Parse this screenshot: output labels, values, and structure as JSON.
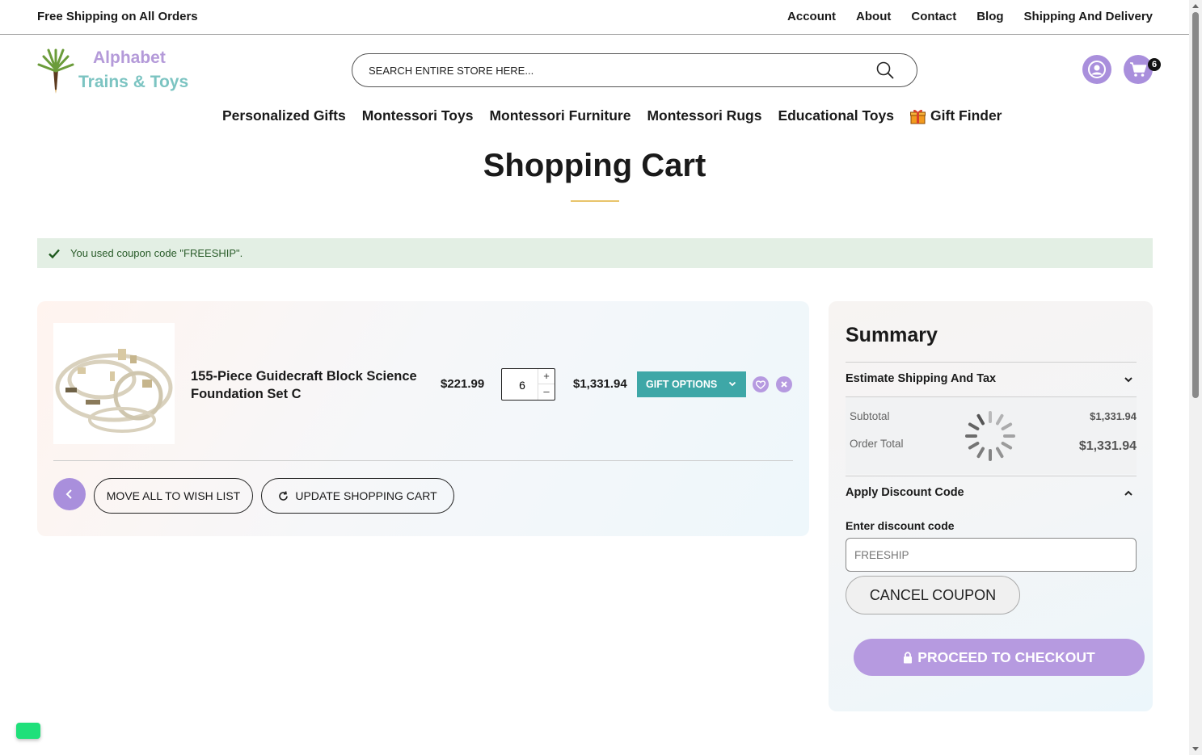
{
  "topbar": {
    "promo": "Free Shipping on All Orders",
    "links": [
      "Account",
      "About",
      "Contact",
      "Blog",
      "Shipping And Delivery"
    ]
  },
  "logo": {
    "line1": "Alphabet",
    "line2": "Trains & Toys"
  },
  "search": {
    "placeholder": "Search entire store here..."
  },
  "header": {
    "cart_count": "6"
  },
  "nav": {
    "items": [
      "Personalized Gifts",
      "Montessori Toys",
      "Montessori Furniture",
      "Montessori Rugs",
      "Educational Toys",
      "Gift Finder"
    ]
  },
  "page": {
    "title": "Shopping Cart"
  },
  "message": {
    "text": "You used coupon code \"FREESHIP\"."
  },
  "cart": {
    "item": {
      "name": "155-Piece Guidecraft Block Science Foundation Set C",
      "price": "$221.99",
      "qty": "6",
      "subtotal": "$1,331.94",
      "gift_options_label": "GIFT OPTIONS"
    },
    "move_all_label": "MOVE ALL TO WISH LIST",
    "update_label": "UPDATE SHOPPING CART"
  },
  "summary": {
    "title": "Summary",
    "estimate_label": "Estimate Shipping And Tax",
    "subtotal_label": "Subtotal",
    "subtotal_value": "$1,331.94",
    "order_total_label": "Order Total",
    "order_total_value": "$1,331.94",
    "discount_title": "Apply Discount Code",
    "discount_label": "Enter discount code",
    "discount_value": "FREESHIP",
    "cancel_label": "CANCEL COUPON",
    "checkout_label": "PROCEED TO CHECKOUT"
  },
  "colors": {
    "accent": "#a98fdc",
    "teal": "#3ea7a7",
    "success_bg": "#e3efe4"
  }
}
